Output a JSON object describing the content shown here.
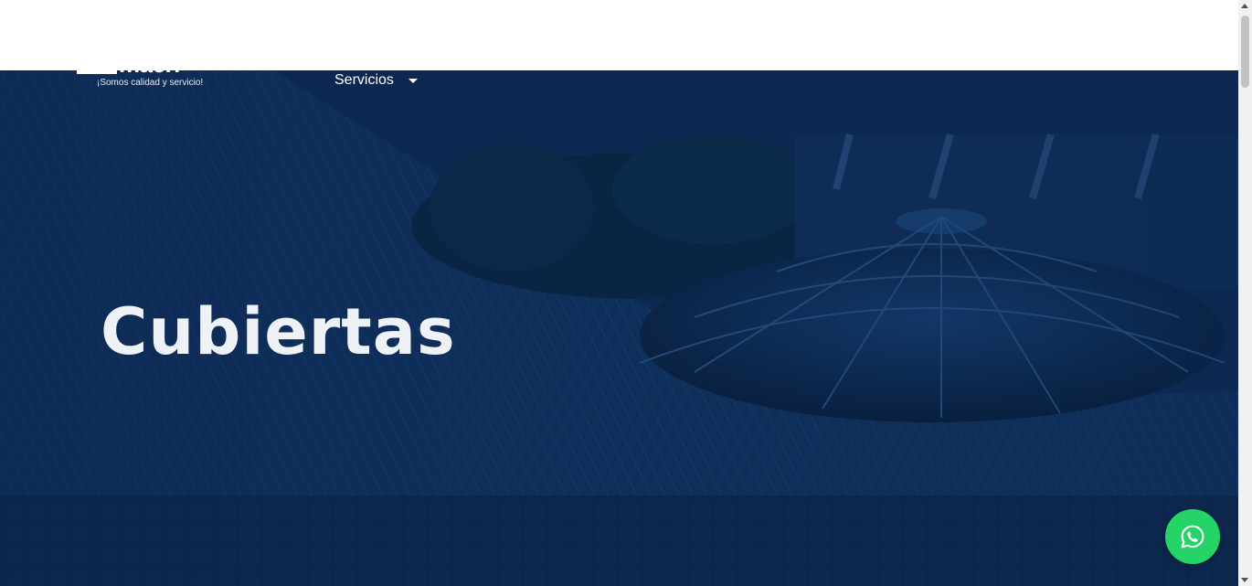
{
  "brand": {
    "wordmark": "macri",
    "tagline": "¡Somos calidad y servicio!"
  },
  "nav": {
    "services_label": "Servicios"
  },
  "hero": {
    "title": "Cubiertas"
  },
  "floating": {
    "whatsapp_icon": "whatsapp-icon"
  },
  "colors": {
    "hero_overlay": "#0c2749",
    "whatsapp": "#25d366",
    "title": "#eef1f6"
  }
}
